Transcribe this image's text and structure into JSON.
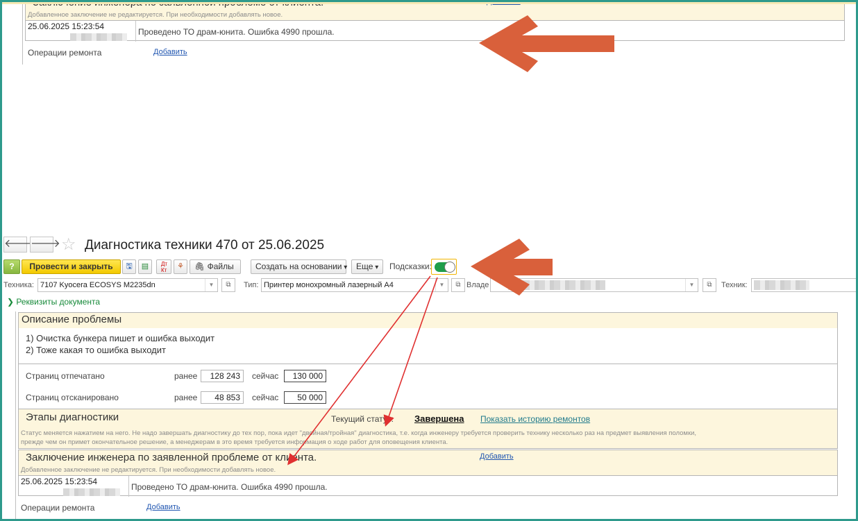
{
  "doc": {
    "title": "Диагностика техники 470 от 25.06.2025",
    "back_glyph": "🡐",
    "fwd_glyph": "🡒",
    "star_glyph": "☆"
  },
  "toolbar": {
    "help": "?",
    "post_close": "Провести и закрыть",
    "save_glyph": "🖫",
    "dt": "Дт",
    "kt": "Кт",
    "files": "Файлы",
    "create_based": "Создать на основании",
    "more": "Еще",
    "hints_label": "Подсказки:"
  },
  "fields": {
    "tech_label": "Техника:",
    "tech_value": "7107 Kyocera ECOSYS M2235dn",
    "type_label": "Тип:",
    "type_value": "Принтер монохромный лазерный А4",
    "owner_label": "Владе",
    "technician_label": "Техник:"
  },
  "requisites_link": "Реквизиты документа",
  "problem": {
    "header": "Описание проблемы",
    "line1": "1) Очистка бункера пишет и ошибка выходит",
    "line2": "2) Тоже какая то ошибка выходит"
  },
  "counters": {
    "printed_label": "Страниц отпечатано",
    "scanned_label": "Страниц отсканировано",
    "before_label": "ранее",
    "now_label": "сейчас",
    "printed_before": "128 243",
    "printed_now": "130 000",
    "scanned_before": "48 853",
    "scanned_now": "50 000"
  },
  "stages": {
    "header": "Этапы диагностики",
    "status_label": "Текущий статус:",
    "status_value": "Завершена",
    "history_link": "Показать историю ремонтов",
    "hint_line1": "Статус меняется нажатием на него. Не надо завершать диагностику до тех пор, пока идет \"двойная/тройная\" диагностика, т.е. когда инженеру требуется проверить технику несколько раз на предмет выявления поломки,",
    "hint_line2": "прежде чем он примет окончательное решение, а менеджерам в это время требуется информация о ходе работ для оповещения клиента."
  },
  "conclusion": {
    "header": "Заключение инженера по заявленной проблеме от клиента.",
    "add_link": "Добавить",
    "hint": "Добавленное заключение не редактируется. При необходимости добавлять новое.",
    "datetime": "25.06.2025 15:23:54",
    "text": "Проведено ТО драм-юнита. Ошибка 4990 прошла.",
    "peek_text": "В"
  },
  "operations": {
    "label": "Операции ремонта",
    "add_link": "Добавить"
  },
  "colors": {
    "callout_arrow": "#d9603b",
    "pointer_arrow": "#e03030",
    "frame": "#2e9a8c"
  }
}
